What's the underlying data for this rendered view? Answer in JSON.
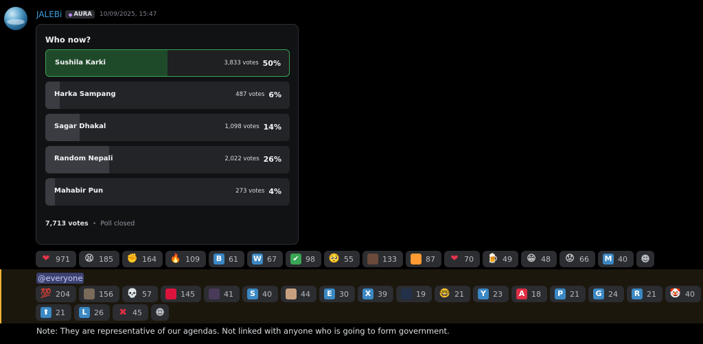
{
  "message": {
    "username": "JALEBi",
    "tag": "AURA",
    "tag_icon": "gem-icon",
    "timestamp": "10/09/2025, 15:47"
  },
  "poll": {
    "question": "Who now?",
    "answers": [
      {
        "label": "Sushila Karki",
        "votes": "3,833 votes",
        "pct": "50%",
        "fraction": 0.5,
        "winner": true
      },
      {
        "label": "Harka Sampang",
        "votes": "487 votes",
        "pct": "6%",
        "fraction": 0.06,
        "winner": false
      },
      {
        "label": "Sagar Dhakal",
        "votes": "1,098 votes",
        "pct": "14%",
        "fraction": 0.14,
        "winner": false
      },
      {
        "label": "Random Nepali",
        "votes": "2,022 votes",
        "pct": "26%",
        "fraction": 0.26,
        "winner": false
      },
      {
        "label": "Mahabir Pun",
        "votes": "273 votes",
        "pct": "4%",
        "fraction": 0.04,
        "winner": false
      }
    ],
    "total": "7,713 votes",
    "status": "Poll closed"
  },
  "reactions_row1": [
    {
      "icon": "red-heart",
      "glyph": "❤",
      "color": "#e8344a",
      "count": "971"
    },
    {
      "icon": "tired-face",
      "glyph": "😫",
      "color": "",
      "count": "185"
    },
    {
      "icon": "raised-fist",
      "glyph": "✊",
      "color": "",
      "count": "164"
    },
    {
      "icon": "fire",
      "glyph": "🔥",
      "color": "",
      "count": "109"
    },
    {
      "icon": "letter-b",
      "glyph": "B",
      "color": "#3b88c3",
      "count": "61"
    },
    {
      "icon": "letter-w",
      "glyph": "W",
      "color": "#3b88c3",
      "count": "67"
    },
    {
      "icon": "check-mark",
      "glyph": "✔",
      "color": "#3aa655",
      "count": "98"
    },
    {
      "icon": "pleading-face",
      "glyph": "🥺",
      "color": "",
      "count": "55"
    },
    {
      "icon": "person-photo",
      "glyph": "",
      "color": "#6b4a3a",
      "count": "133"
    },
    {
      "icon": "india-flag",
      "glyph": "",
      "color": "#ff9933",
      "count": "87"
    },
    {
      "icon": "red-heart",
      "glyph": "❤",
      "color": "#e8344a",
      "count": "70"
    },
    {
      "icon": "beer-mug",
      "glyph": "🍺",
      "color": "",
      "count": "49"
    },
    {
      "icon": "grinning-face",
      "glyph": "😁",
      "color": "",
      "count": "48"
    },
    {
      "icon": "worried-face",
      "glyph": "😟",
      "color": "",
      "count": "66"
    },
    {
      "icon": "letter-m",
      "glyph": "M",
      "color": "#3b88c3",
      "count": "40"
    }
  ],
  "everyone_mention": "@everyone",
  "reactions_row2": [
    {
      "icon": "hundred-points",
      "glyph": "💯",
      "color": "",
      "count": "204"
    },
    {
      "icon": "person-photo",
      "glyph": "",
      "color": "#7a6a5a",
      "count": "156"
    },
    {
      "icon": "skull",
      "glyph": "💀",
      "color": "",
      "count": "57"
    },
    {
      "icon": "nepal-flag",
      "glyph": "",
      "color": "#dc143c",
      "count": "145"
    },
    {
      "icon": "person-photo",
      "glyph": "",
      "color": "#4a3a5a",
      "count": "41"
    },
    {
      "icon": "letter-s",
      "glyph": "S",
      "color": "#3b88c3",
      "count": "40"
    },
    {
      "icon": "person-photo",
      "glyph": "",
      "color": "#c8a080",
      "count": "44"
    },
    {
      "icon": "letter-e",
      "glyph": "E",
      "color": "#3b88c3",
      "count": "30"
    },
    {
      "icon": "letter-x",
      "glyph": "X",
      "color": "#3b88c3",
      "count": "39"
    },
    {
      "icon": "flag-image",
      "glyph": "",
      "color": "#22304a",
      "count": "19"
    },
    {
      "icon": "nerd-face",
      "glyph": "🤓",
      "color": "",
      "count": "21"
    },
    {
      "icon": "letter-y",
      "glyph": "Y",
      "color": "#3b88c3",
      "count": "23"
    },
    {
      "icon": "letter-a",
      "glyph": "A",
      "color": "#dd2e44",
      "count": "18"
    },
    {
      "icon": "letter-p",
      "glyph": "P",
      "color": "#3b88c3",
      "count": "21"
    },
    {
      "icon": "letter-g",
      "glyph": "G",
      "color": "#3b88c3",
      "count": "24"
    },
    {
      "icon": "letter-r",
      "glyph": "R",
      "color": "#3b88c3",
      "count": "21"
    },
    {
      "icon": "clown-face",
      "glyph": "🤡",
      "color": "",
      "count": "40"
    }
  ],
  "reactions_row3": [
    {
      "icon": "up-arrow",
      "glyph": "⬆",
      "color": "#3b88c3",
      "count": "21"
    },
    {
      "icon": "letter-l",
      "glyph": "L",
      "color": "#3b88c3",
      "count": "26"
    },
    {
      "icon": "cross-mark",
      "glyph": "✖",
      "color": "",
      "count": "45"
    }
  ],
  "add_reaction_icon": "add-reaction-icon",
  "note": "Note: They are representative of our agendas. Not linked with anyone who is going to form government."
}
